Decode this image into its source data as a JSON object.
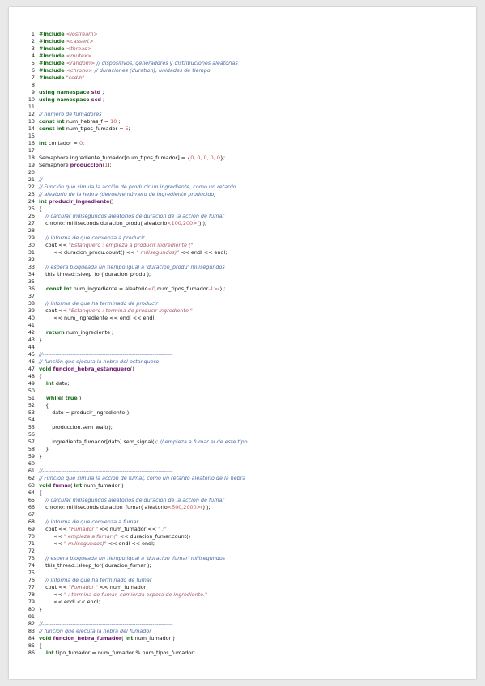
{
  "document": {
    "lines": [
      [
        [
          "kw",
          "#include "
        ],
        [
          "str",
          "<iostream>"
        ]
      ],
      [
        [
          "kw",
          "#include "
        ],
        [
          "str",
          "<cassert>"
        ]
      ],
      [
        [
          "kw",
          "#include "
        ],
        [
          "str",
          "<thread>"
        ]
      ],
      [
        [
          "kw",
          "#include "
        ],
        [
          "str",
          "<mutex>"
        ]
      ],
      [
        [
          "kw",
          "#include "
        ],
        [
          "str",
          "<random>"
        ],
        [
          "cm",
          " // dispositivos, generadores y distribuciones aleatorias"
        ]
      ],
      [
        [
          "kw",
          "#include "
        ],
        [
          "str",
          "<chrono>"
        ],
        [
          "cm",
          " // duraciones (duration), unidades de tiempo"
        ]
      ],
      [
        [
          "kw",
          "#include "
        ],
        [
          "str",
          "\"scd.h\""
        ]
      ],
      [],
      [
        [
          "kw",
          "using namespace "
        ],
        [
          "fn",
          "std"
        ],
        [
          "t",
          " ;"
        ]
      ],
      [
        [
          "kw",
          "using namespace "
        ],
        [
          "fn",
          "scd"
        ],
        [
          "t",
          " ;"
        ]
      ],
      [],
      [
        [
          "cm",
          "// número de fumadores"
        ]
      ],
      [
        [
          "kw",
          "const int "
        ],
        [
          "t",
          "num_hebras_f = "
        ],
        [
          "num",
          "10"
        ],
        [
          "t",
          " ;"
        ]
      ],
      [
        [
          "kw",
          "const int "
        ],
        [
          "t",
          "num_tipos_fumador = "
        ],
        [
          "num",
          "5"
        ],
        [
          "t",
          ";"
        ]
      ],
      [],
      [
        [
          "kw",
          "int "
        ],
        [
          "t",
          "contador = "
        ],
        [
          "num",
          "0"
        ],
        [
          "t",
          ";"
        ]
      ],
      [],
      [
        [
          "t",
          "Semaphore ingrediente_fumador[num_tipos_fumador] = {"
        ],
        [
          "num",
          "0"
        ],
        [
          "t",
          ", "
        ],
        [
          "num",
          "0"
        ],
        [
          "t",
          ", "
        ],
        [
          "num",
          "0"
        ],
        [
          "t",
          ", "
        ],
        [
          "num",
          "0"
        ],
        [
          "t",
          ", "
        ],
        [
          "num",
          "0"
        ],
        [
          "t",
          "};"
        ]
      ],
      [
        [
          "t",
          "Semaphore "
        ],
        [
          "fn",
          "produccion"
        ],
        [
          "t",
          "("
        ],
        [
          "num",
          "1"
        ],
        [
          "t",
          ");"
        ]
      ],
      [],
      [
        [
          "cm",
          "//----------------------------------------------------------------------"
        ]
      ],
      [
        [
          "cm",
          "// Función que simula la acción de producir un ingrediente, como un retardo"
        ]
      ],
      [
        [
          "cm",
          "// aleatorio de la hebra (devuelve número de ingrediente producido)"
        ]
      ],
      [
        [
          "kw",
          "int "
        ],
        [
          "fn",
          "producir_ingrediente"
        ],
        [
          "t",
          "()"
        ]
      ],
      [
        [
          "t",
          "{"
        ]
      ],
      [
        [
          "cm",
          "    // calcular milisegundos aleatorios de duración de la acción de fumar"
        ]
      ],
      [
        [
          "t",
          "    chrono::milliseconds duracion_produ( aleatorio"
        ],
        [
          "str",
          "<"
        ],
        [
          "num",
          "100"
        ],
        [
          "str",
          ","
        ],
        [
          "num",
          "200"
        ],
        [
          "str",
          ">"
        ],
        [
          "t",
          "() );"
        ]
      ],
      [],
      [
        [
          "cm",
          "    // informa de que comienza a producir"
        ]
      ],
      [
        [
          "t",
          "    cout << "
        ],
        [
          "str",
          "\"Estanquero : empieza a producir ingrediente (\""
        ]
      ],
      [
        [
          "t",
          "         << duracion_produ.count() << "
        ],
        [
          "str",
          "\" milisegundos)\""
        ],
        [
          "t",
          " << endl << endl;"
        ]
      ],
      [],
      [
        [
          "cm",
          "    // espera bloqueada un tiempo igual a 'duracion_produ' milisegundos"
        ]
      ],
      [
        [
          "t",
          "    this_thread::sleep_for( duracion_produ );"
        ]
      ],
      [],
      [
        [
          "kw",
          "    const int "
        ],
        [
          "t",
          "num_ingrediente = aleatorio"
        ],
        [
          "str",
          "<"
        ],
        [
          "num",
          "0"
        ],
        [
          "str",
          ","
        ],
        [
          "t",
          "num_tipos_fumador"
        ],
        [
          "str",
          "-"
        ],
        [
          "num",
          "1"
        ],
        [
          "str",
          ">"
        ],
        [
          "t",
          "() ;"
        ]
      ],
      [],
      [
        [
          "cm",
          "    // informa de que ha terminado de producir"
        ]
      ],
      [
        [
          "t",
          "    cout << "
        ],
        [
          "str",
          "\"Estanquero : termina de producir ingrediente \""
        ]
      ],
      [
        [
          "t",
          "         << num_ingrediente << endl << endl;"
        ]
      ],
      [],
      [
        [
          "kw",
          "    return "
        ],
        [
          "t",
          "num_ingrediente ;"
        ]
      ],
      [
        [
          "t",
          "}"
        ]
      ],
      [],
      [
        [
          "cm",
          "//----------------------------------------------------------------------"
        ]
      ],
      [
        [
          "cm",
          "// función que ejecuta la hebra del estanquero"
        ]
      ],
      [
        [
          "kw",
          "void "
        ],
        [
          "fn",
          "funcion_hebra_estanquero"
        ],
        [
          "t",
          "()"
        ]
      ],
      [
        [
          "t",
          "{"
        ]
      ],
      [
        [
          "kw",
          "    int "
        ],
        [
          "t",
          "dato;"
        ]
      ],
      [],
      [
        [
          "kw",
          "    while"
        ],
        [
          "t",
          "( "
        ],
        [
          "kw",
          "true"
        ],
        [
          "t",
          " )"
        ]
      ],
      [
        [
          "t",
          "    {"
        ]
      ],
      [
        [
          "t",
          "        dato = producir_ingrediente();"
        ]
      ],
      [],
      [
        [
          "t",
          "        produccion.sem_wait();"
        ]
      ],
      [],
      [
        [
          "t",
          "        ingrediente_fumador[dato].sem_signal(); "
        ],
        [
          "cm",
          "// empieza a fumar el de este tipo"
        ]
      ],
      [
        [
          "t",
          "    }"
        ]
      ],
      [
        [
          "t",
          "}"
        ]
      ],
      [],
      [
        [
          "cm",
          "//----------------------------------------------------------------------"
        ]
      ],
      [
        [
          "cm",
          "// Función que simula la acción de fumar, como un retardo aleatorio de la hebra"
        ]
      ],
      [
        [
          "kw",
          "void "
        ],
        [
          "fn",
          "fumar"
        ],
        [
          "t",
          "( "
        ],
        [
          "kw",
          "int "
        ],
        [
          "t",
          "num_fumador )"
        ]
      ],
      [
        [
          "t",
          "{"
        ]
      ],
      [
        [
          "cm",
          "    // calcular milisegundos aleatorios de duración de la acción de fumar"
        ]
      ],
      [
        [
          "t",
          "    chrono::milliseconds duracion_fumar( aleatorio"
        ],
        [
          "str",
          "<"
        ],
        [
          "num",
          "500"
        ],
        [
          "str",
          ","
        ],
        [
          "num",
          "2000"
        ],
        [
          "str",
          ">"
        ],
        [
          "t",
          "() );"
        ]
      ],
      [],
      [
        [
          "cm",
          "    // informa de que comienza a fumar"
        ]
      ],
      [
        [
          "t",
          "    cout << "
        ],
        [
          "str",
          "\"Fumador \""
        ],
        [
          "t",
          " << num_fumador << "
        ],
        [
          "str",
          "\" :\""
        ]
      ],
      [
        [
          "t",
          "         << "
        ],
        [
          "str",
          "\" empieza a fumar (\""
        ],
        [
          "t",
          " << duracion_fumar.count()"
        ]
      ],
      [
        [
          "t",
          "         << "
        ],
        [
          "str",
          "\" milisegundos)\""
        ],
        [
          "t",
          " << endl << endl;"
        ]
      ],
      [],
      [
        [
          "cm",
          "    // espera bloqueada un tiempo igual a 'duracion_fumar' milisegundos"
        ]
      ],
      [
        [
          "t",
          "    this_thread::sleep_for( duracion_fumar );"
        ]
      ],
      [],
      [
        [
          "cm",
          "    // informa de que ha terminado de fumar"
        ]
      ],
      [
        [
          "t",
          "    cout << "
        ],
        [
          "str",
          "\"Fumador \""
        ],
        [
          "t",
          " << num_fumador"
        ]
      ],
      [
        [
          "t",
          "         << "
        ],
        [
          "str",
          "\" : termina de fumar, comienza espera de ingrediente.\""
        ]
      ],
      [
        [
          "t",
          "         << endl << endl;"
        ]
      ],
      [
        [
          "t",
          "}"
        ]
      ],
      [],
      [
        [
          "cm",
          "//----------------------------------------------------------------------"
        ]
      ],
      [
        [
          "cm",
          "// función que ejecuta la hebra del fumador"
        ]
      ],
      [
        [
          "kw",
          "void "
        ],
        [
          "fn",
          "funcion_hebra_fumador"
        ],
        [
          "t",
          "( "
        ],
        [
          "kw",
          "int "
        ],
        [
          "t",
          "num_fumador )"
        ]
      ],
      [
        [
          "t",
          "{"
        ]
      ],
      [
        [
          "kw",
          "    int "
        ],
        [
          "t",
          "tipo_fumador = num_fumador % num_tipos_fumador;"
        ]
      ]
    ]
  }
}
